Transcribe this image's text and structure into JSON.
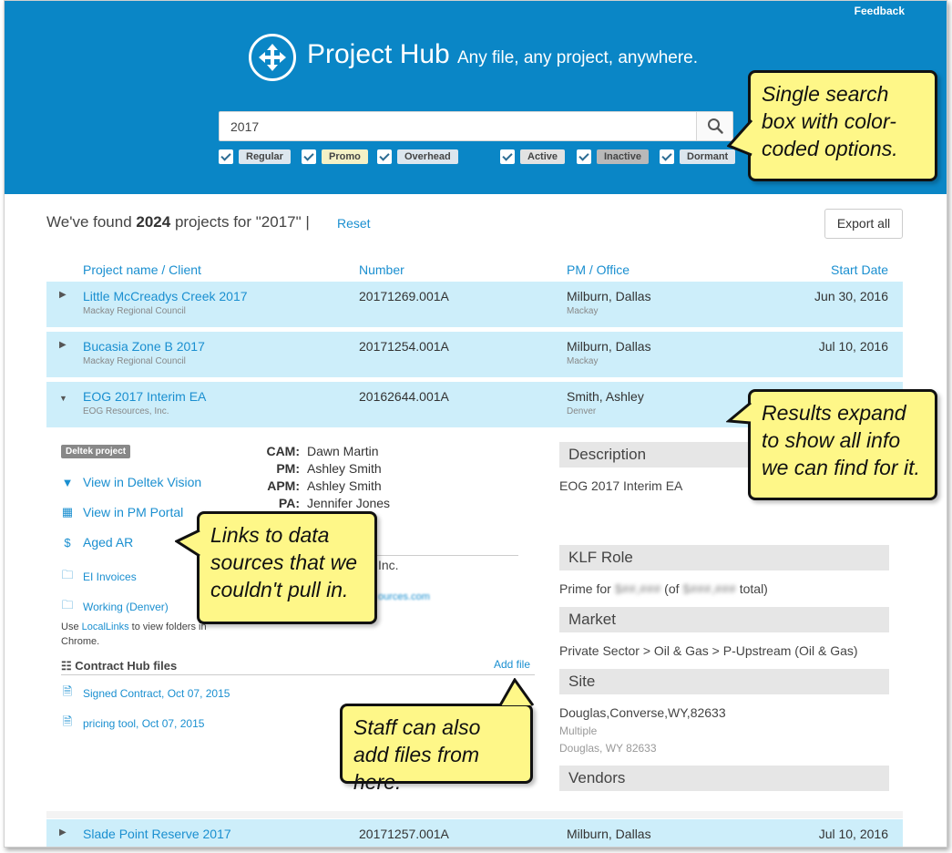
{
  "header": {
    "feedback": "Feedback",
    "app_title": "Project Hub",
    "tagline": "Any file, any project, anywhere.",
    "search_value": "2017",
    "filters": [
      "Regular",
      "Promo",
      "Overhead",
      "Active",
      "Inactive",
      "Dormant"
    ],
    "filter_colors": {
      "Regular": "#dce6ee",
      "Promo": "#f4f1c6",
      "Overhead": "#dce6ee",
      "Active": "#e2e2e2",
      "Inactive": "#b9b9b9",
      "Dormant": "#dce6ee"
    }
  },
  "results": {
    "found_prefix": "We've found ",
    "count": "2024",
    "found_suffix": " projects for \"2017\" |",
    "reset": "Reset",
    "export": "Export all",
    "col_name": "Project name / Client",
    "col_number": "Number",
    "col_pm": "PM / Office",
    "col_start": "Start Date",
    "rows": [
      {
        "name": "Little McCreadys Creek 2017",
        "client": "Mackay Regional Council",
        "number": "20171269.001A",
        "pm": "Milburn, Dallas",
        "office": "Mackay",
        "start": "Jun 30, 2016"
      },
      {
        "name": "Bucasia Zone B 2017",
        "client": "Mackay Regional Council",
        "number": "20171254.001A",
        "pm": "Milburn, Dallas",
        "office": "Mackay",
        "start": "Jul 10, 2016"
      },
      {
        "name": "EOG 2017 Interim EA",
        "client": "EOG Resources, Inc.",
        "number": "20162644.001A",
        "pm": "Smith, Ashley",
        "office": "Denver",
        "start": ""
      },
      {
        "name": "Slade Point Reserve 2017",
        "client": "",
        "number": "20171257.001A",
        "pm": "Milburn, Dallas",
        "office": "",
        "start": "Jul 10, 2016"
      }
    ]
  },
  "detail": {
    "badge": "Deltek project",
    "links": [
      "View in Deltek Vision",
      "View in PM Portal",
      "Aged AR",
      "EI Invoices",
      "Working (Denver)"
    ],
    "note_prefix": "Use ",
    "note_link": "LocalLinks",
    "note_suffix": " to view folders in Chrome.",
    "contract_head": "Contract Hub files",
    "add_file": "Add file",
    "files": [
      "Signed Contract, Oct 07, 2015",
      "pricing tool, Oct 07, 2015"
    ],
    "roles": [
      {
        "k": "CAM:",
        "v": "Dawn Martin"
      },
      {
        "k": "PM:",
        "v": "Ashley Smith"
      },
      {
        "k": "APM:",
        "v": "Ashley Smith"
      },
      {
        "k": "PA:",
        "v": "Jennifer Jones"
      }
    ],
    "client_frag": "Inc.",
    "email_frag": "ources.com",
    "description_head": "Description",
    "description": "EOG 2017 Interim EA",
    "klf_head": "KLF Role",
    "klf_a": "Prime for ",
    "klf_amt1": "$##,###",
    "klf_b": " (of ",
    "klf_amt2": "$###,###",
    "klf_c": " total)",
    "market_head": "Market",
    "market": "Private Sector > Oil & Gas > P-Upstream (Oil & Gas)",
    "site_head": "Site",
    "site_line1": "Douglas,Converse,WY,82633",
    "site_line2": "Multiple",
    "site_line3": "Douglas, WY 82633",
    "vendors_head": "Vendors"
  },
  "callouts": {
    "search": "Single search box with color-coded options.",
    "expand": "Results expand to show all info we can find for it.",
    "links": "Links to data sources that we couldn't pull in.",
    "staff": "Staff can also add files from here."
  }
}
